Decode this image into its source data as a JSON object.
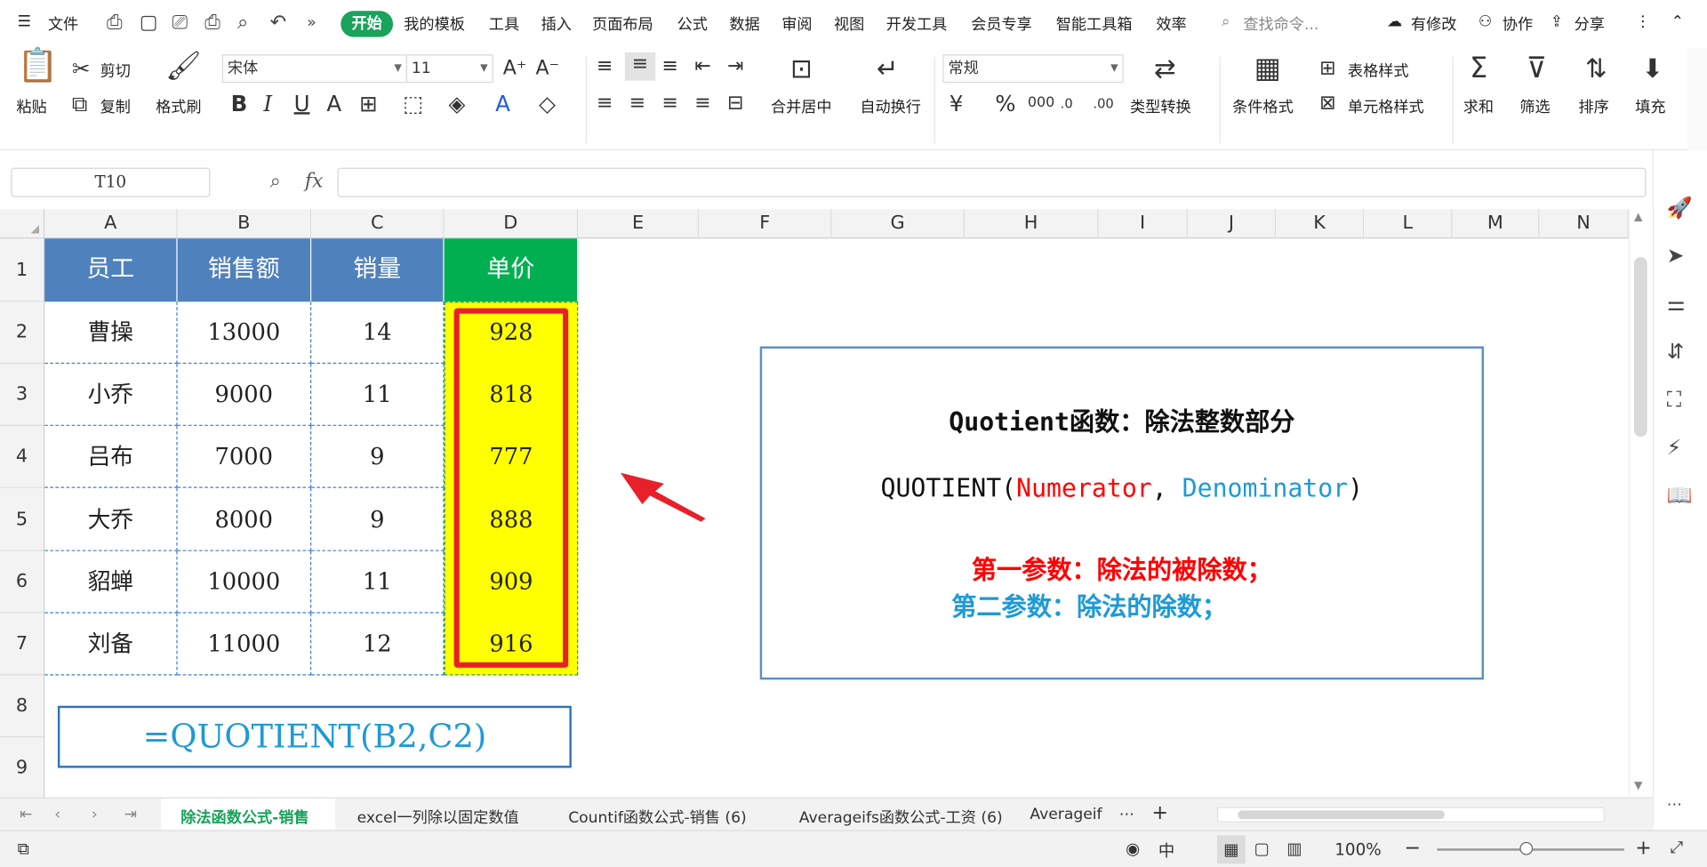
{
  "menubar": {
    "file": "文件",
    "start": "开始",
    "items": [
      "我的模板",
      "工具",
      "插入",
      "页面布局",
      "公式",
      "数据",
      "审阅",
      "视图",
      "开发工具",
      "会员专享",
      "智能工具箱",
      "效率"
    ],
    "search_placeholder": "查找命令...",
    "modified": "有修改",
    "collaborate": "协作",
    "share": "分享"
  },
  "ribbon": {
    "paste": "粘贴",
    "cut": "剪切",
    "copy": "复制",
    "format_painter": "格式刷",
    "font_name": "宋体",
    "font_size": "11",
    "merge_center": "合并居中",
    "auto_wrap": "自动换行",
    "number_format": "常规",
    "type_convert": "类型转换",
    "cond_format": "条件格式",
    "table_style": "表格样式",
    "cell_style": "单元格样式",
    "sum": "求和",
    "filter": "筛选",
    "sort": "排序",
    "fill": "填充"
  },
  "formula_bar": {
    "name_box": "T10",
    "fx": "fx",
    "value": ""
  },
  "columns": [
    "A",
    "B",
    "C",
    "D",
    "E",
    "F",
    "G",
    "H",
    "I",
    "J",
    "K",
    "L",
    "M",
    "N"
  ],
  "rows": [
    "1",
    "2",
    "3",
    "4",
    "5",
    "6",
    "7",
    "8",
    "9"
  ],
  "table": {
    "headers": [
      "员工",
      "销售额",
      "销量",
      "单价"
    ],
    "data": [
      [
        "曹操",
        "13000",
        "14",
        "928"
      ],
      [
        "小乔",
        "9000",
        "11",
        "818"
      ],
      [
        "吕布",
        "7000",
        "9",
        "777"
      ],
      [
        "大乔",
        "8000",
        "9",
        "888"
      ],
      [
        "貂蝉",
        "10000",
        "11",
        "909"
      ],
      [
        "刘备",
        "11000",
        "12",
        "916"
      ]
    ]
  },
  "formula_box": "=QUOTIENT(B2,C2)",
  "info_box": {
    "title": "Quotient函数：除法整数部分",
    "syntax_prefix": "QUOTIENT(",
    "arg1": "Numerator",
    "sep": ", ",
    "arg2": "Denominator",
    "syntax_suffix": ")",
    "line1": "第一参数：除法的被除数；",
    "line2": "第二参数：除法的除数；"
  },
  "sheet_tabs": [
    "除法函数公式-销售",
    "excel一列除以固定数值",
    "Countif函数公式-销售 (6)",
    "Averageifs函数公式-工资 (6)",
    "Averageif"
  ],
  "status": {
    "zoom": "100%"
  },
  "colors": {
    "header_blue": "#4f81bd",
    "header_green": "#00b050",
    "highlight_yellow": "#ffff00",
    "red_border": "#e8202a",
    "accent_green": "#19a35b",
    "info_red": "#ff0000",
    "info_blue": "#1e9ad6"
  }
}
